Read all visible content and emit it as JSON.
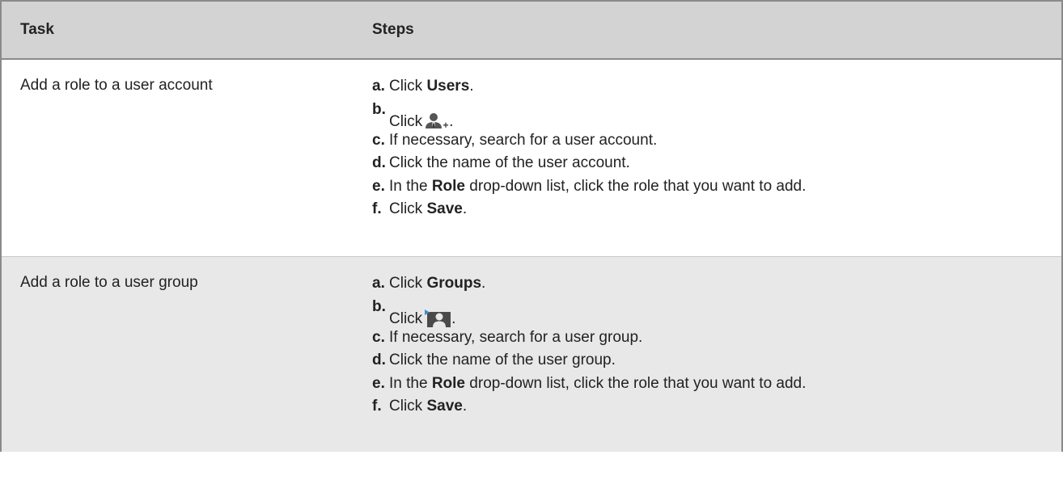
{
  "table": {
    "header": {
      "task": "Task",
      "steps": "Steps"
    },
    "rows": [
      {
        "task": "Add a role to a user account",
        "steps": {
          "a": {
            "letter": "a.",
            "pre": "Click ",
            "bold": "Users",
            "post": "."
          },
          "b": {
            "letter": "b.",
            "pre": "Click",
            "icon": "add-user-icon",
            "post": "."
          },
          "c": {
            "letter": "c.",
            "text": "If necessary, search for a user account."
          },
          "d": {
            "letter": "d.",
            "text": "Click the name of the user account."
          },
          "e": {
            "letter": "e.",
            "pre": "In the ",
            "bold": "Role",
            "post": " drop-down list, click the role that you want to add."
          },
          "f": {
            "letter": "f.",
            "pre": "Click ",
            "bold": "Save",
            "post": "."
          }
        }
      },
      {
        "task": "Add a role to a user group",
        "steps": {
          "a": {
            "letter": "a.",
            "pre": "Click ",
            "bold": "Groups",
            "post": "."
          },
          "b": {
            "letter": "b.",
            "pre": "Click",
            "icon": "add-group-icon",
            "post": "."
          },
          "c": {
            "letter": "c.",
            "text": "If necessary, search for a user group."
          },
          "d": {
            "letter": "d.",
            "text": "Click the name of the user group."
          },
          "e": {
            "letter": "e.",
            "pre": "In the ",
            "bold": "Role",
            "post": " drop-down list, click the role that you want to add."
          },
          "f": {
            "letter": "f.",
            "pre": "Click ",
            "bold": "Save",
            "post": "."
          }
        }
      }
    ]
  }
}
